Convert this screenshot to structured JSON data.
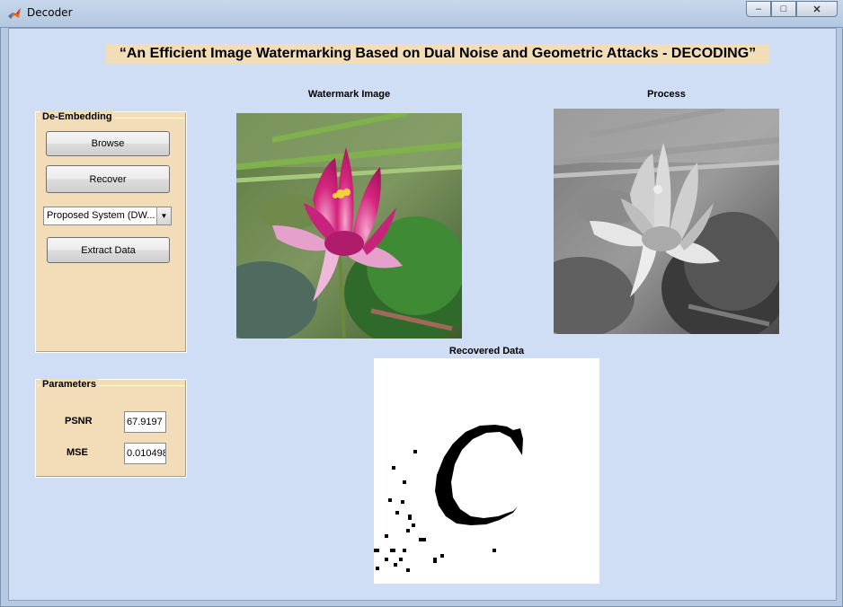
{
  "window": {
    "title": "Decoder",
    "minimize_icon": "minimize-icon",
    "maximize_icon": "maximize-icon",
    "close_icon": "close-icon"
  },
  "banner": {
    "text": "“An Efficient Image Watermarking Based on Dual Noise and Geometric Attacks - DECODING”"
  },
  "de_embedding": {
    "title": "De-Embedding",
    "browse_label": "Browse",
    "recover_label": "Recover",
    "method_selected": "Proposed System (DW...",
    "extract_label": "Extract Data"
  },
  "parameters": {
    "title": "Parameters",
    "psnr_label": "PSNR",
    "psnr_value": "67.9197",
    "mse_label": "MSE",
    "mse_value": "0.010498"
  },
  "images": {
    "watermark_title": "Watermark Image",
    "process_title": "Process",
    "recovered_title": "Recovered Data"
  },
  "colors": {
    "background": "#cfdef5",
    "panel": "#f3ddb9",
    "flower_pink": "#d6277f"
  }
}
